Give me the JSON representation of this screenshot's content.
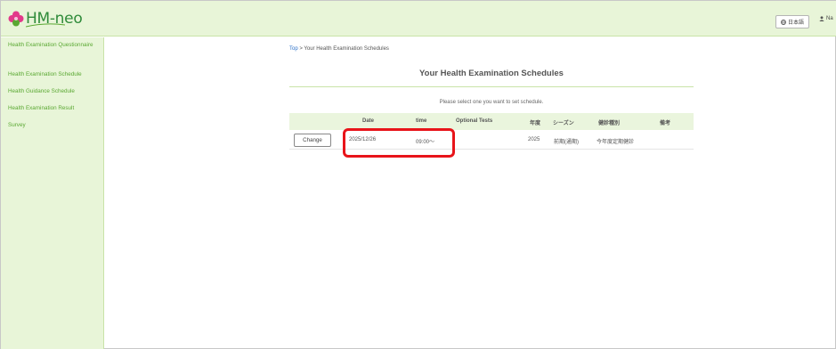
{
  "app": {
    "logo_text": "HM-neo",
    "language_button": "日本語",
    "user_label": "Na"
  },
  "sidebar": {
    "items": [
      {
        "label": "Health Examination Questionnaire"
      },
      {
        "label": "Health Examination Schedule"
      },
      {
        "label": "Health Guidance Schedule"
      },
      {
        "label": "Health Examination Result"
      },
      {
        "label": "Survey"
      }
    ]
  },
  "breadcrumb": {
    "top": "Top",
    "separator": " > ",
    "current": "Your Health Examination Schedules"
  },
  "page": {
    "title": "Your Health Examination Schedules",
    "instruction": "Please select one you want to set schedule."
  },
  "table": {
    "headers": [
      "",
      "Date",
      "time",
      "Optional Tests",
      "年度",
      "シーズン",
      "健診種別",
      "備考"
    ],
    "rows": [
      {
        "action": "Change",
        "date": "2025/12/26",
        "time": "09:00～",
        "optional_tests": "",
        "year": "2025",
        "season": "前期(通期)",
        "exam_type": "今年度定期健診",
        "remarks": ""
      }
    ]
  },
  "colors": {
    "brand_green": "#5aa832",
    "header_bg": "#e8f5d8",
    "highlight": "#e8141a"
  }
}
